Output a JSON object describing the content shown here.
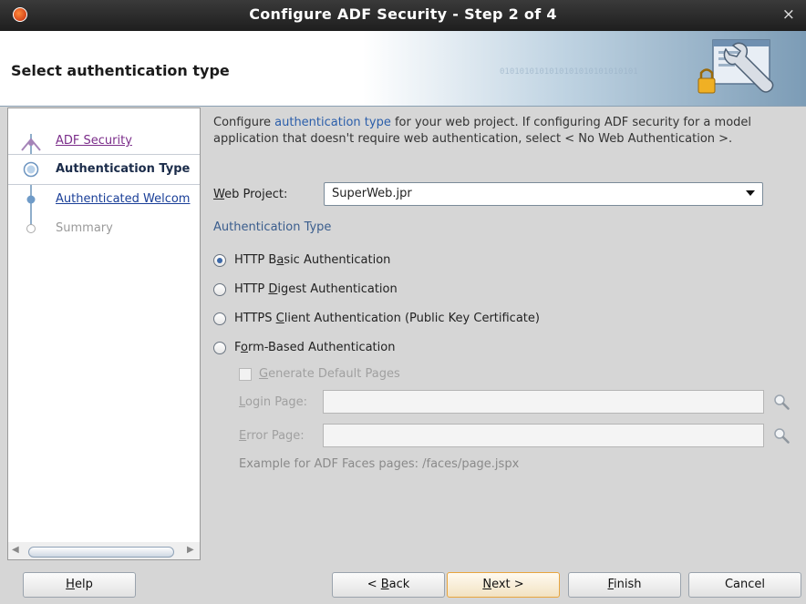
{
  "window": {
    "title": "Configure ADF Security - Step 2 of 4",
    "close_glyph": "×"
  },
  "header": {
    "heading": "Select authentication type",
    "binary_text": "0101010101010101010101010101"
  },
  "steps": [
    {
      "label": "ADF Security",
      "state": "visited"
    },
    {
      "label": "Authentication Type",
      "state": "current"
    },
    {
      "label": "Authenticated Welcom",
      "state": "link"
    },
    {
      "label": "Summary",
      "state": "disabled"
    }
  ],
  "sidebar": {
    "scroll_left": "◀",
    "scroll_right": "▶"
  },
  "description": {
    "part1": "Configure ",
    "link": "authentication type",
    "part2": " for your web project. If configuring ADF security for a model application that doesn't require web authentication, select < No Web Authentication >."
  },
  "web_project": {
    "label_mnemonic": "W",
    "label_rest": "eb Project:",
    "value": "SuperWeb.jpr"
  },
  "auth_section": {
    "title": "Authentication Type"
  },
  "auth_options": [
    {
      "pre": "HTTP B",
      "mnemonic": "a",
      "post": "sic Authentication",
      "selected": true
    },
    {
      "pre": "HTTP ",
      "mnemonic": "D",
      "post": "igest Authentication",
      "selected": false
    },
    {
      "pre": "HTTPS ",
      "mnemonic": "C",
      "post": "lient Authentication (Public Key Certificate)",
      "selected": false
    },
    {
      "pre": "F",
      "mnemonic": "o",
      "post": "rm-Based Authentication",
      "selected": false
    }
  ],
  "form_based": {
    "generate_mnemonic": "G",
    "generate_rest": "enerate Default Pages",
    "login_mnemonic": "L",
    "login_rest": "ogin Page:",
    "login_value": "",
    "error_mnemonic": "E",
    "error_rest": "rror Page:",
    "error_value": "",
    "example": "Example for ADF Faces pages: /faces/page.jspx"
  },
  "buttons": {
    "help_m": "H",
    "help_rest": "elp",
    "back_pre": "< ",
    "back_m": "B",
    "back_rest": "ack",
    "next_m": "N",
    "next_rest": "ext >",
    "finish_m": "F",
    "finish_rest": "inish",
    "cancel": "Cancel"
  },
  "colors": {
    "title_bar": "#2b2b2b",
    "link": "#1a3f98",
    "visited_link": "#7b2d8a",
    "section_title": "#3a5d8d",
    "primary_button_border": "#e8a53e"
  }
}
